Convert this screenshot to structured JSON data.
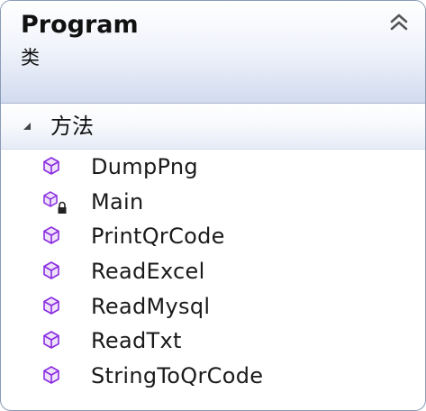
{
  "class_shape": {
    "name": "Program",
    "kind": "类",
    "collapse_icon": "double-chevron-up-icon"
  },
  "section": {
    "label": "方法",
    "toggle_icon": "expanded-triangle-icon"
  },
  "methods": [
    {
      "name": "DumpPng",
      "icon": "method-icon"
    },
    {
      "name": "Main",
      "icon": "private-method-icon"
    },
    {
      "name": "PrintQrCode",
      "icon": "method-icon"
    },
    {
      "name": "ReadExcel",
      "icon": "method-icon"
    },
    {
      "name": "ReadMysql",
      "icon": "method-icon"
    },
    {
      "name": "ReadTxt",
      "icon": "method-icon"
    },
    {
      "name": "StringToQrCode",
      "icon": "method-icon"
    }
  ],
  "colors": {
    "method_icon": "#8a2be2",
    "border": "#8a9bb5",
    "header_gradient_bottom": "#d2dbef"
  }
}
